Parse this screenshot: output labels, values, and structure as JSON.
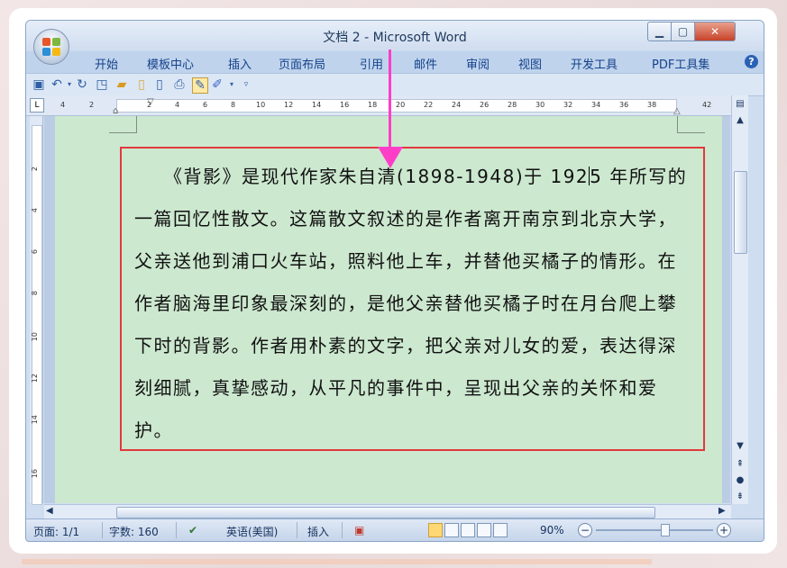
{
  "window": {
    "title": "文档 2 - Microsoft Word",
    "minimize": "▁",
    "maximize": "▢",
    "close": "✕"
  },
  "ribbon": {
    "tabs": [
      "开始",
      "模板中心",
      "插入",
      "页面布局",
      "引用",
      "邮件",
      "审阅",
      "视图",
      "开发工具",
      "PDF工具集"
    ],
    "help": "?"
  },
  "ruler": {
    "tab_selector": "L",
    "ticks": [
      "4",
      "2",
      "2",
      "4",
      "6",
      "8",
      "10",
      "12",
      "14",
      "16",
      "18",
      "20",
      "22",
      "24",
      "26",
      "28",
      "30",
      "32",
      "34",
      "36",
      "38",
      "42"
    ],
    "vticks": [
      "2",
      "4",
      "6",
      "8",
      "10",
      "12",
      "14",
      "16"
    ]
  },
  "document": {
    "text_before_caret": "《背影》是现代作家朱自清(1898-1948)于 192",
    "text_after_caret": "5 年所写的一篇回忆性散文。这篇散文叙述的是作者离开南京到北京大学，父亲送他到浦口火车站，照料他上车，并替他买橘子的情形。在作者脑海里印象最深刻的，是他父亲替他买橘子时在月台爬上攀下时的背影。作者用朴素的文字，把父亲对儿女的爱，表达得深刻细腻，真挚感动，从平凡的事件中，呈现出父亲的关怀和爱护。",
    "indent": "　　"
  },
  "status": {
    "page": "页面: 1/1",
    "words": "字数: 160",
    "language": "英语(美国)",
    "mode": "插入",
    "zoom": "90%"
  },
  "colors": {
    "highlight_border": "#e2383d",
    "arrow": "#ff3ec8",
    "page_bg": "#cce8cf"
  }
}
